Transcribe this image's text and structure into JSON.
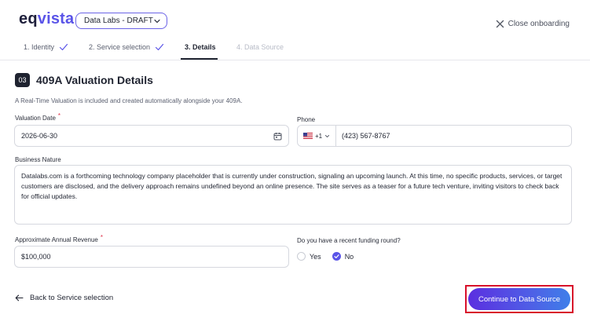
{
  "brand": {
    "logo_part1": "eq",
    "logo_part2": "vista",
    "accent_color": "#5a54e8"
  },
  "header": {
    "company_select": "Data Labs - DRAFT",
    "close_label": "Close onboarding"
  },
  "steps": [
    {
      "label": "1. Identity",
      "state": "done"
    },
    {
      "label": "2. Service selection",
      "state": "done"
    },
    {
      "label": "3. Details",
      "state": "active"
    },
    {
      "label": "4. Data Source",
      "state": "disabled"
    }
  ],
  "section": {
    "number": "03",
    "title": "409A Valuation Details",
    "description": "A Real-Time Valuation is included and created automatically alongside your 409A."
  },
  "form": {
    "valuation_date": {
      "label": "Valuation Date",
      "required_mark": "*",
      "value": "2026-06-30"
    },
    "phone": {
      "label": "Phone",
      "country_code": "+1",
      "value": "(423) 567-8767"
    },
    "business_nature": {
      "label": "Business Nature",
      "value": "Datalabs.com is a forthcoming technology company placeholder that is currently under construction, signaling an upcoming launch. At this time, no specific products, services, or target customers are disclosed, and the delivery approach remains undefined beyond an online presence. The site serves as a teaser for a future tech venture, inviting visitors to check back for official updates."
    },
    "annual_revenue": {
      "label": "Approximate Annual Revenue",
      "required_mark": "*",
      "value": "$100,000"
    },
    "funding_round": {
      "label": "Do you have a recent funding round?",
      "options": [
        "Yes",
        "No"
      ],
      "selected": "No"
    }
  },
  "footer": {
    "back_label": "Back to Service selection",
    "continue_label": "Continue to Data Source"
  }
}
